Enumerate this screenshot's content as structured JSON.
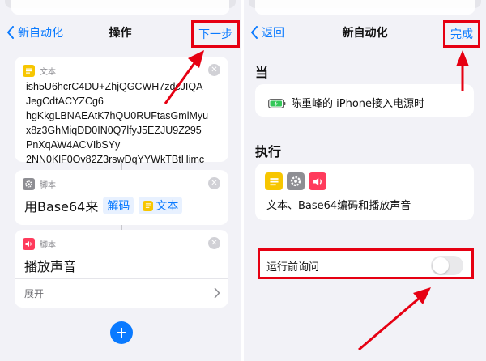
{
  "left_screen": {
    "back_label": "新自动化",
    "title": "操作",
    "next_label": "下一步",
    "text_card": {
      "header": "文本",
      "icon": "text-doc-icon",
      "lines": [
        "ish5U6hcrC4DU+ZhjQGCWH7zdcJIQA",
        "JegCdtACYZCg6",
        "hgKkgLBNAEAtK7hQU0RUFtasGmlMyu",
        "x8z3GhMiqDD0IN0Q7lfyJ5EZJU9Z295",
        "PnXqAW4ACVIbSYy",
        "2NN0KlF0Ov82Z3rswDqYYWkTBtHimc"
      ]
    },
    "script_card": {
      "header": "脚本",
      "icon": "gear-icon",
      "prefix": "用Base64来",
      "decode_token": "解码",
      "text_token": "文本"
    },
    "sound_card": {
      "header": "脚本",
      "icon": "speaker-icon",
      "action": "播放声音",
      "expand_label": "展开"
    }
  },
  "right_screen": {
    "back_label": "返回",
    "title": "新自动化",
    "done_label": "完成",
    "when_heading": "当",
    "trigger_text": "陈重峰的 iPhone接入电源时",
    "do_heading": "执行",
    "action_icons": [
      "text-doc-icon",
      "gear-icon",
      "speaker-icon"
    ],
    "action_summary": "文本、Base64编码和播放声音",
    "ask_label": "运行前询问",
    "ask_toggle_on": false
  },
  "colors": {
    "accent": "#0a7aff",
    "highlight": "#e60012",
    "text_icon": "#f7c600",
    "script_icon": "#8e8e93",
    "sound_icon": "#ff3b5c"
  }
}
